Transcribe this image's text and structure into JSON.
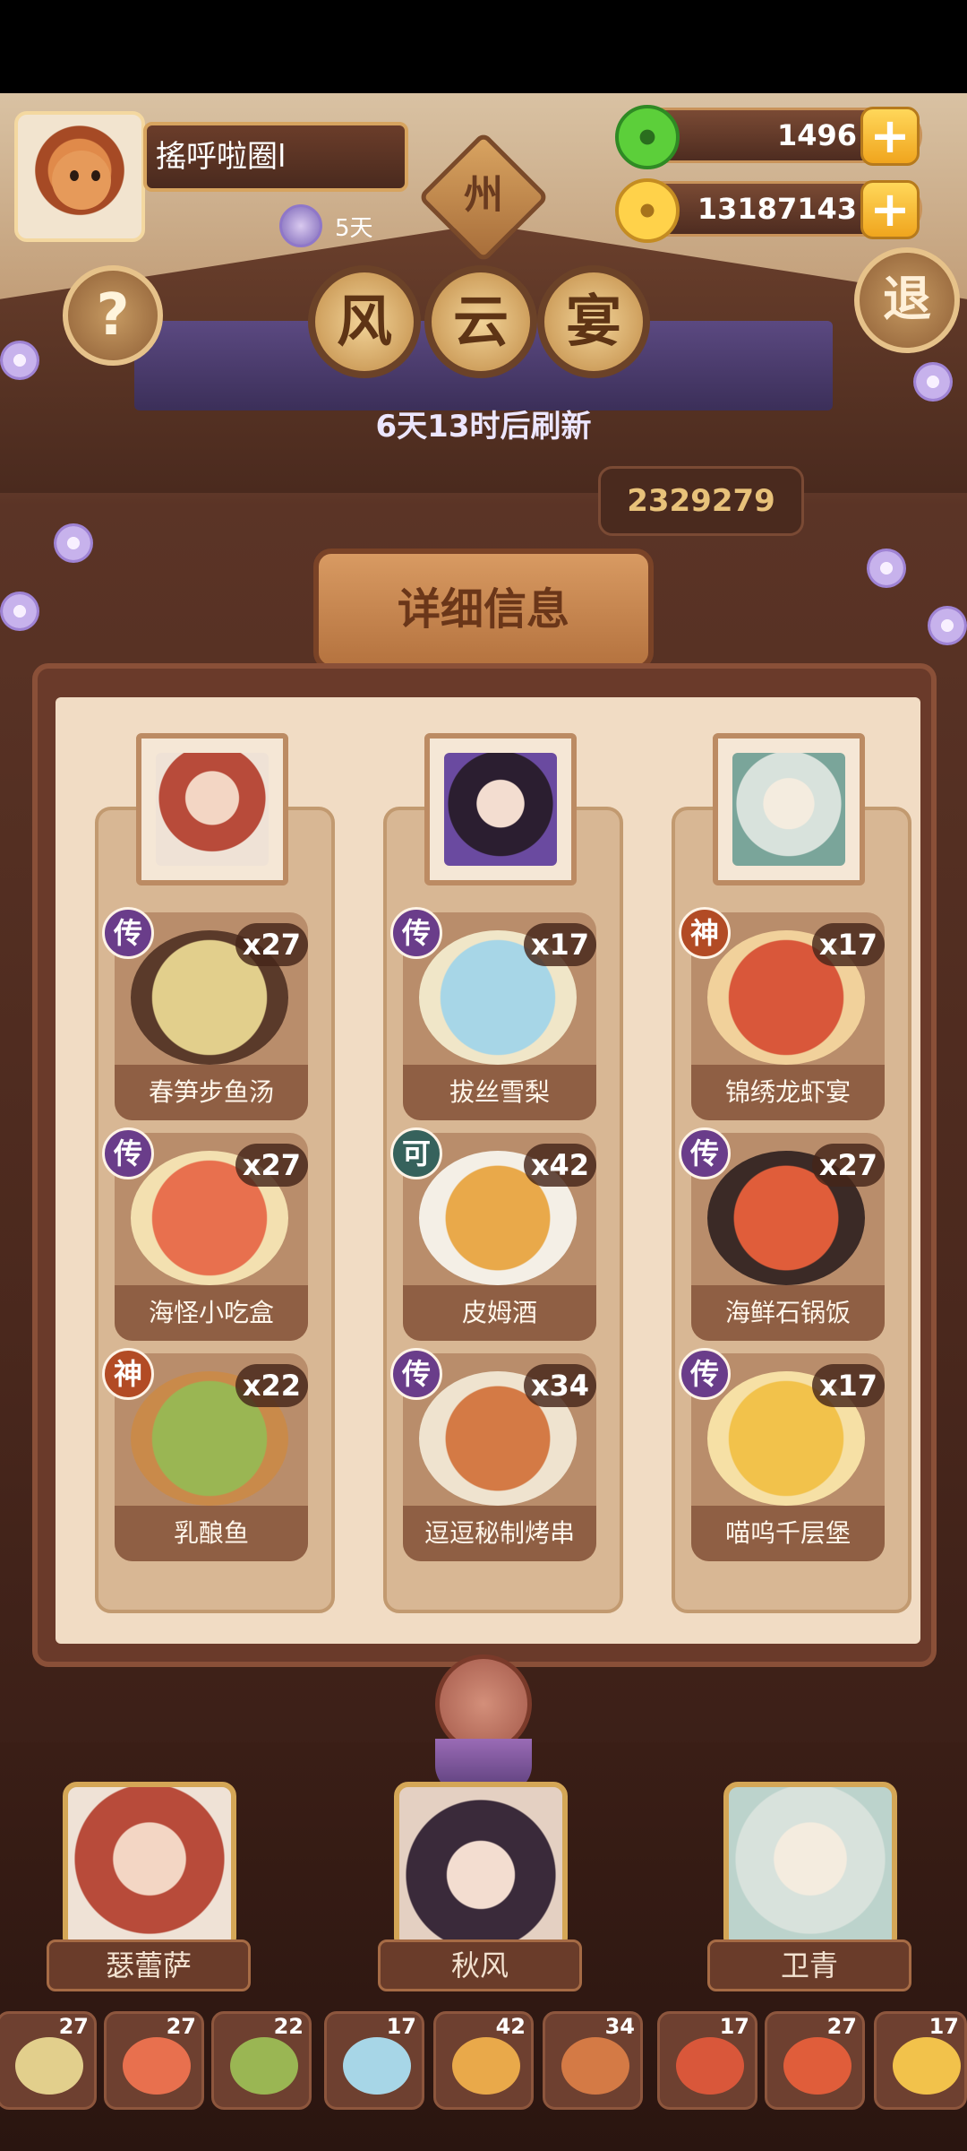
{
  "player": {
    "name": "搖呼啦圈l",
    "days": "5天"
  },
  "region_tag": "州",
  "currencies": {
    "jade": "1496",
    "gold": "13187143"
  },
  "title_chars": [
    "风",
    "云",
    "宴"
  ],
  "refresh_text": "6天13时后刷新",
  "score": "2329279",
  "plaque_title": "详细信息",
  "buttons": {
    "help": "?",
    "exit": "退",
    "plus": "+"
  },
  "columns": [
    {
      "dishes": [
        {
          "name": "春笋步鱼汤",
          "tier": "传",
          "count": "x27",
          "color": "#e2cf8c"
        },
        {
          "name": "海怪小吃盒",
          "tier": "传",
          "count": "x27",
          "color": "#e8704e"
        },
        {
          "name": "乳酿鱼",
          "tier": "神",
          "count": "x22",
          "color": "#9ab653"
        }
      ]
    },
    {
      "dishes": [
        {
          "name": "拔丝雪梨",
          "tier": "传",
          "count": "x17",
          "color": "#a7d6e7"
        },
        {
          "name": "皮姆酒",
          "tier": "可",
          "count": "x42",
          "color": "#e9a94a"
        },
        {
          "name": "逗逗秘制烤串",
          "tier": "传",
          "count": "x34",
          "color": "#d47a45"
        }
      ]
    },
    {
      "dishes": [
        {
          "name": "锦绣龙虾宴",
          "tier": "神",
          "count": "x17",
          "color": "#d9573a"
        },
        {
          "name": "海鲜石锅饭",
          "tier": "传",
          "count": "x27",
          "color": "#e05d3a"
        },
        {
          "name": "喵呜千层堡",
          "tier": "传",
          "count": "x17",
          "color": "#f2c24b"
        }
      ]
    }
  ],
  "characters": [
    {
      "name": "瑟蕾萨",
      "color": "#b84b3a"
    },
    {
      "name": "秋风",
      "color": "#3a2a3a"
    },
    {
      "name": "卫青",
      "color": "#d8e2dc"
    }
  ],
  "thumbnails": [
    {
      "count": "27",
      "color": "#e2cf8c"
    },
    {
      "count": "27",
      "color": "#e8704e"
    },
    {
      "count": "22",
      "color": "#9ab653"
    },
    {
      "count": "17",
      "color": "#a7d6e7"
    },
    {
      "count": "42",
      "color": "#e9a94a"
    },
    {
      "count": "34",
      "color": "#d47a45"
    },
    {
      "count": "17",
      "color": "#d9573a"
    },
    {
      "count": "27",
      "color": "#e05d3a"
    },
    {
      "count": "17",
      "color": "#f2c24b"
    }
  ]
}
